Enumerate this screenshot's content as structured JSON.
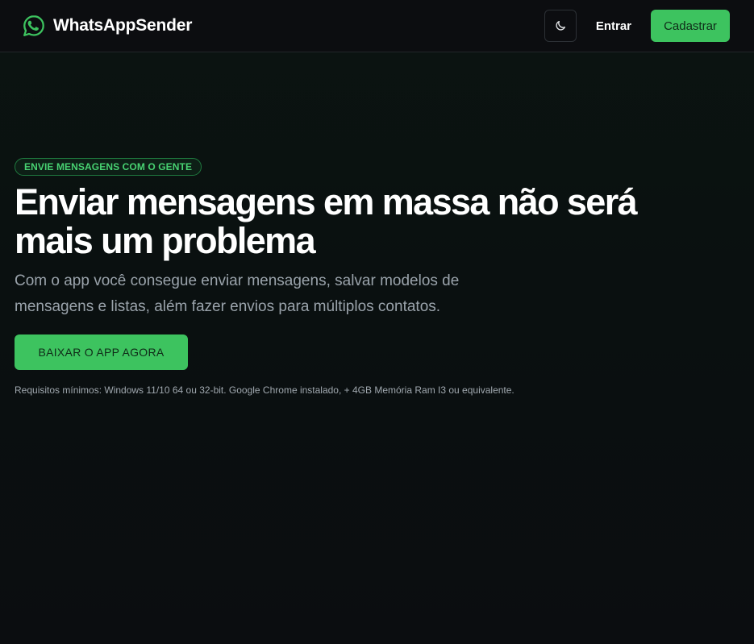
{
  "header": {
    "brand": "WhatsAppSender",
    "login_label": "Entrar",
    "signup_label": "Cadastrar"
  },
  "hero": {
    "badge": "ENVIE MENSAGENS COM O GENTE",
    "headline": "Enviar mensagens em massa não será mais um problema",
    "lead": "Com o app você consegue enviar mensagens, salvar modelos de mensagens e listas, além fazer envios para múltiplos contatos.",
    "download_label": "BAIXAR O APP AGORA",
    "requirements": "Requisitos mínimos: Windows 11/10 64 ou 32-bit. Google Chrome instalado, + 4GB Memória Ram I3 ou equivalente."
  },
  "icons": {
    "brand": "whatsapp-icon",
    "theme_toggle": "moon-icon"
  },
  "colors": {
    "accent": "#3dc35f",
    "background": "#0b0e10",
    "header": "#0c0d10"
  }
}
